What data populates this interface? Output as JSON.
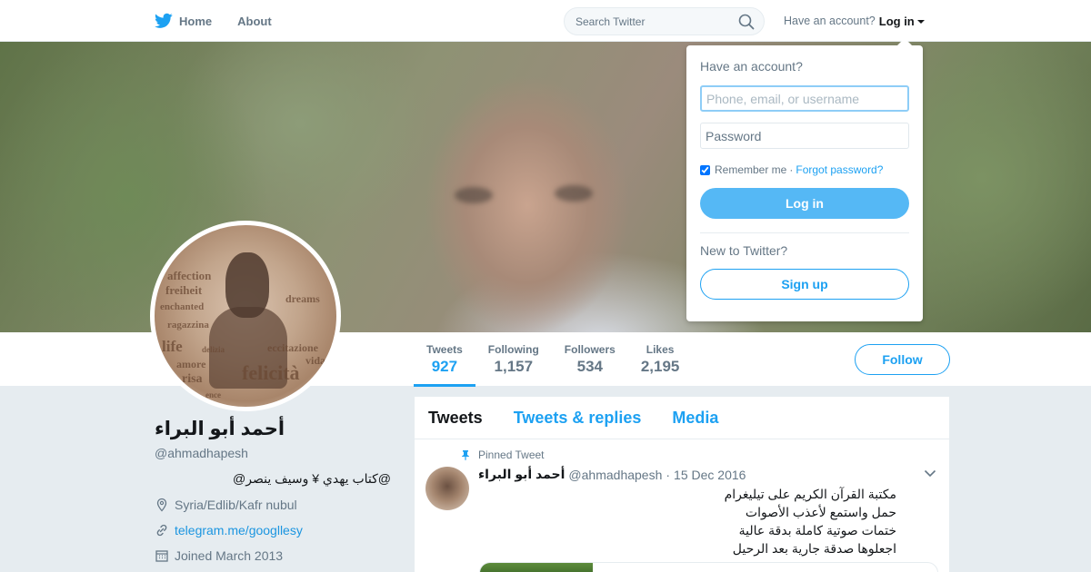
{
  "nav": {
    "home_label": "Home",
    "about_label": "About",
    "search_placeholder": "Search Twitter",
    "have_account": "Have an account?",
    "login_label": "Log in"
  },
  "profile": {
    "name": "أحمد أبو البراء",
    "handle": "@ahmadhapesh",
    "bio": "@كتاب يهدي ¥ وسيف ينصر@",
    "location": "Syria/Edlib/Kafr nubul",
    "link": "telegram.me/googllesy",
    "joined": "Joined March 2013",
    "avatar_words": [
      "affection",
      "freiheit",
      "enchanted",
      "dreams",
      "ragazzina",
      "life",
      "eccitazione",
      "vida",
      "delizia",
      "amore",
      "risa",
      "felicità",
      "ence"
    ]
  },
  "stats": [
    {
      "label": "Tweets",
      "value": "927"
    },
    {
      "label": "Following",
      "value": "1,157"
    },
    {
      "label": "Followers",
      "value": "534"
    },
    {
      "label": "Likes",
      "value": "2,195"
    }
  ],
  "follow_label": "Follow",
  "tabs": {
    "tweets": "Tweets",
    "replies": "Tweets & replies",
    "media": "Media"
  },
  "pinned_tweet": {
    "pinned_label": "Pinned Tweet",
    "author_name": "أحمد أبو البراء",
    "author_handle": "@ahmadhapesh",
    "separator": "·",
    "date": "15 Dec 2016",
    "lines": [
      "مكتبة القرآن الكريم على تيليغرام",
      "حمل واستمع لأعذب الأصوات",
      "ختمات صوتية كاملة بدقة عالية",
      "اجعلوها صدقة جارية بعد الرحيل"
    ]
  },
  "login_dropdown": {
    "title": "Have an account?",
    "username_placeholder": "Phone, email, or username",
    "password_placeholder": "Password",
    "remember_label": "Remember me",
    "separator": "·",
    "forgot_label": "Forgot password?",
    "login_button": "Log in",
    "new_label": "New to Twitter?",
    "signup_button": "Sign up"
  },
  "colors": {
    "accent": "#1da1f2",
    "background": "#e6ecf0"
  }
}
